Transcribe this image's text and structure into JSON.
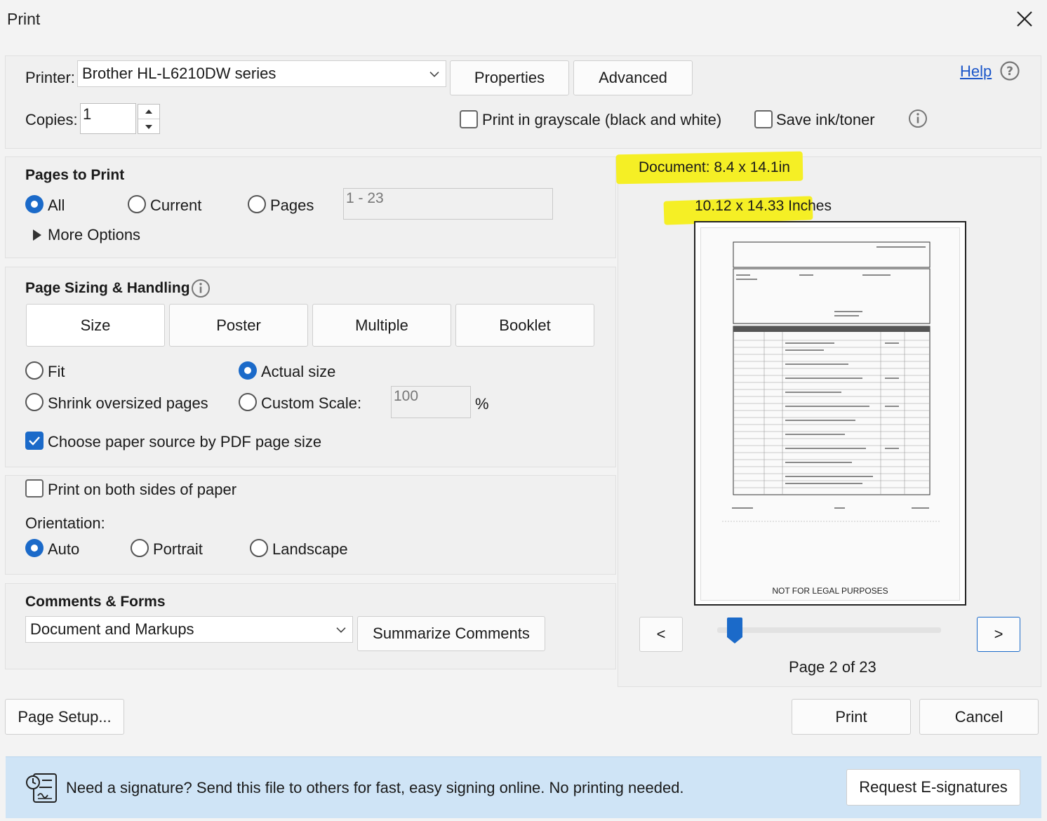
{
  "window": {
    "title": "Print"
  },
  "printer": {
    "label": "Printer:",
    "selected": "Brother HL-L6210DW series",
    "properties_label": "Properties",
    "advanced_label": "Advanced",
    "help_label": "Help"
  },
  "copies": {
    "label": "Copies:",
    "value": "1"
  },
  "options": {
    "grayscale_label": "Print in grayscale (black and white)",
    "grayscale_checked": false,
    "save_ink_label": "Save ink/toner",
    "save_ink_checked": false
  },
  "pages_to_print": {
    "heading": "Pages to Print",
    "all_label": "All",
    "current_label": "Current",
    "pages_label": "Pages",
    "range_value": "1 - 23",
    "selected": "All",
    "more_options_label": "More Options"
  },
  "page_sizing": {
    "heading": "Page Sizing & Handling",
    "tabs": [
      "Size",
      "Poster",
      "Multiple",
      "Booklet"
    ],
    "selected_tab": "Size",
    "fit_label": "Fit",
    "actual_size_label": "Actual size",
    "shrink_label": "Shrink oversized pages",
    "custom_scale_label": "Custom Scale:",
    "scale_value": "100",
    "scale_unit": "%",
    "selected": "Actual size",
    "paper_source_label": "Choose paper source by PDF page size",
    "paper_source_checked": true
  },
  "duplex": {
    "both_sides_label": "Print on both sides of paper",
    "both_sides_checked": false,
    "orientation_label": "Orientation:",
    "auto_label": "Auto",
    "portrait_label": "Portrait",
    "landscape_label": "Landscape",
    "selected": "Auto"
  },
  "comments_forms": {
    "heading": "Comments & Forms",
    "selected": "Document and Markups",
    "summarize_label": "Summarize Comments"
  },
  "preview": {
    "document_size": "Document: 8.4 x 14.1in",
    "paper_size": "10.12 x 14.33 Inches",
    "page_footer_text": "NOT FOR LEGAL PURPOSES",
    "prev_label": "<",
    "next_label": ">",
    "page_indicator": "Page 2 of 23",
    "current_page": 2,
    "total_pages": 23
  },
  "footer": {
    "page_setup_label": "Page Setup...",
    "print_label": "Print",
    "cancel_label": "Cancel"
  },
  "banner": {
    "message": "Need a signature? Send this file to others for fast, easy signing online. No printing needed.",
    "button_label": "Request E-signatures"
  },
  "colors": {
    "accent": "#1b6ac9",
    "highlight": "#f5ef25",
    "banner_bg": "#cfe4f6",
    "link": "#1b56c9"
  }
}
